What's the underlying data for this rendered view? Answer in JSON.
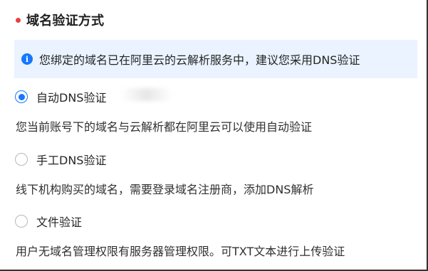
{
  "section": {
    "title": "域名验证方式"
  },
  "notice": {
    "icon": "info-icon",
    "text": "您绑定的域名已在阿里云的云解析服务中，建议您采用DNS验证"
  },
  "options": [
    {
      "label": "自动DNS验证",
      "selected": true,
      "description": "您当前账号下的域名与云解析都在阿里云可以使用自动验证"
    },
    {
      "label": "手工DNS验证",
      "selected": false,
      "description": "线下机构购买的域名，需要登录域名注册商，添加DNS解析"
    },
    {
      "label": "文件验证",
      "selected": false,
      "description": "用户无域名管理权限有服务器管理权限。可TXT文本进行上传验证"
    }
  ],
  "colors": {
    "accent": "#1677ff",
    "required_dot": "#ea3f3f",
    "notice_bg": "#eaf3ff"
  }
}
